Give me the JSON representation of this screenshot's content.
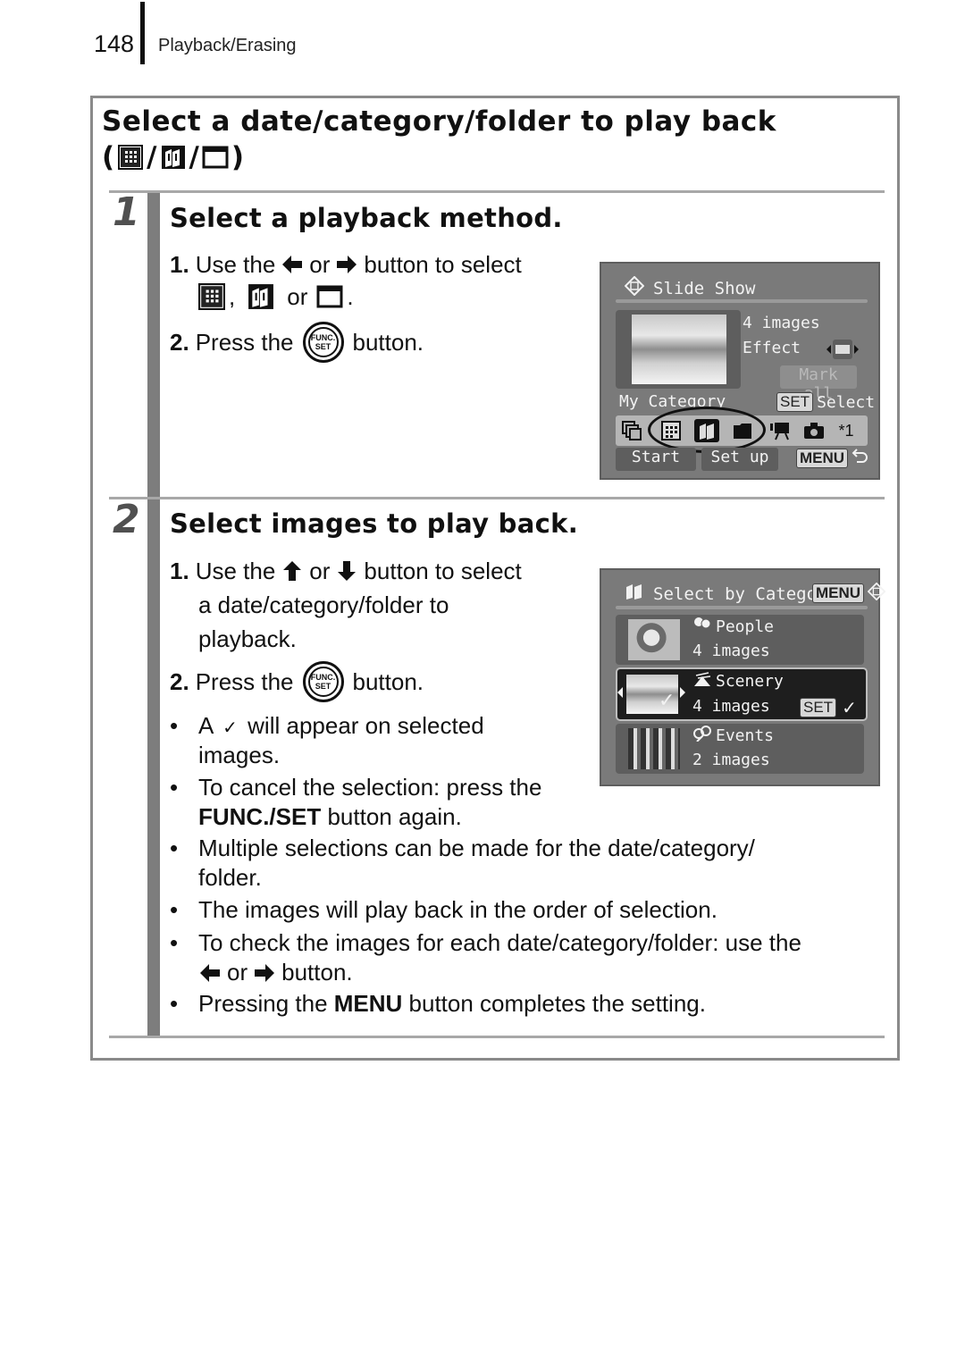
{
  "header": {
    "page_number": "148",
    "section": "Playback/Erasing"
  },
  "title": {
    "line1": "Select a date/category/folder to play back",
    "open_paren": "(",
    "sep": "/",
    "close_paren": ")",
    "icons": [
      "calendar-icon",
      "category-icon",
      "folder-icon"
    ]
  },
  "steps": [
    {
      "number": "1",
      "title": "Select a playback method.",
      "instructions": {
        "i1_num": "1.",
        "i1_a": "Use the",
        "i1_or": "or",
        "i1_b": "button to select",
        "i1_comma": ",",
        "i1_or2": "or",
        "i1_period": ".",
        "i2_num": "2.",
        "i2_a": "Press the",
        "i2_b": "button."
      },
      "screen": {
        "title": "Slide Show",
        "image_count": "4 images",
        "effect_label": "Effect",
        "mark_all": "Mark all",
        "mode_label": "My Category",
        "set_tag": "SET",
        "select_label": "Select",
        "multiplier": "*1",
        "start_button": "Start",
        "setup_button": "Set up",
        "menu_tag": "MENU"
      }
    },
    {
      "number": "2",
      "title": "Select images to play back.",
      "instructions": {
        "i1_num": "1.",
        "i1_a": "Use the",
        "i1_or": "or",
        "i1_b": "button to select",
        "i1_line2": "a date/category/folder to",
        "i1_line3": "playback.",
        "i2_num": "2.",
        "i2_a": "Press the",
        "i2_b": "button."
      },
      "bullets": {
        "b1_a": "A",
        "b1_check": "✓",
        "b1_b": "will appear on selected",
        "b1_line2": "images.",
        "b2_line1": "To cancel the selection: press the",
        "b2_bold": "FUNC./SET",
        "b2_rest": " button again.",
        "b3_line1": "Multiple selections can be made for the date/category/",
        "b3_line2": "folder.",
        "b4": "The images will play back in the order of selection.",
        "b5_line1": "To check the images for each date/category/folder: use the",
        "b5_or": "or",
        "b5_end": "button.",
        "b6_a": "Pressing the ",
        "b6_bold": "MENU",
        "b6_b": " button completes the setting."
      },
      "screen": {
        "title": "Select by Category",
        "menu_tag": "MENU",
        "set_tag": "SET",
        "categories": [
          {
            "name": "People",
            "count": "4 images",
            "selected": false
          },
          {
            "name": "Scenery",
            "count": "4 images",
            "selected": true
          },
          {
            "name": "Events",
            "count": "2 images",
            "selected": false
          }
        ]
      }
    }
  ],
  "func_button": {
    "line1": "FUNC.",
    "line2": "SET"
  },
  "bullet_char": "•"
}
